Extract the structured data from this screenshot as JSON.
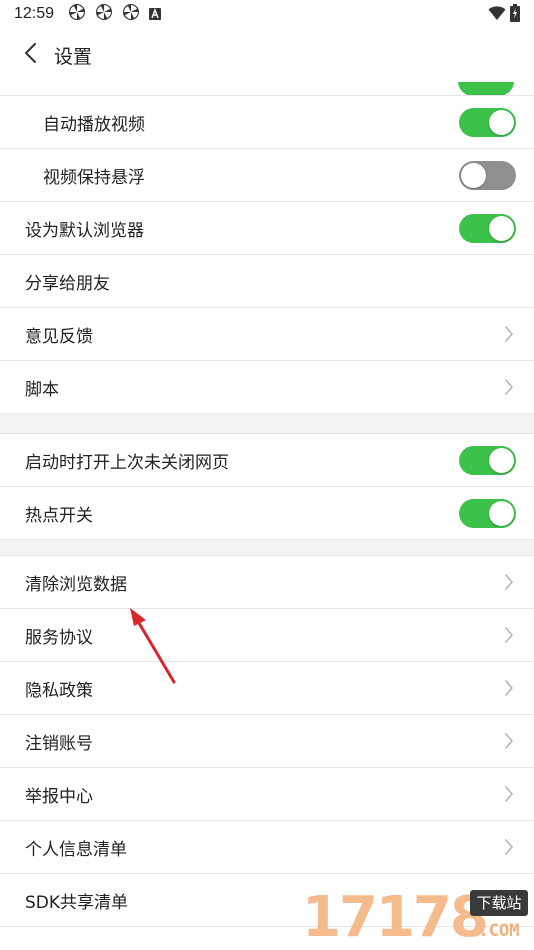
{
  "status_bar": {
    "time": "12:59",
    "notification_icons": [
      "pinwheel-icon",
      "pinwheel-icon",
      "pinwheel-icon",
      "a-square-icon"
    ]
  },
  "header": {
    "title": "设置"
  },
  "groups": [
    [
      {
        "label": "自动播放视频",
        "type": "toggle",
        "on": true,
        "indent": true
      },
      {
        "label": "视频保持悬浮",
        "type": "toggle",
        "on": false,
        "indent": true
      },
      {
        "label": "设为默认浏览器",
        "type": "toggle",
        "on": true,
        "indent": false
      },
      {
        "label": "分享给朋友",
        "type": "plain",
        "indent": false
      },
      {
        "label": "意见反馈",
        "type": "chevron",
        "indent": false
      },
      {
        "label": "脚本",
        "type": "chevron",
        "indent": false
      }
    ],
    [
      {
        "label": "启动时打开上次未关闭网页",
        "type": "toggle",
        "on": true,
        "indent": false
      },
      {
        "label": "热点开关",
        "type": "toggle",
        "on": true,
        "indent": false
      }
    ],
    [
      {
        "label": "清除浏览数据",
        "type": "chevron",
        "indent": false
      },
      {
        "label": "服务协议",
        "type": "chevron",
        "indent": false
      },
      {
        "label": "隐私政策",
        "type": "chevron",
        "indent": false
      },
      {
        "label": "注销账号",
        "type": "chevron",
        "indent": false
      },
      {
        "label": "举报中心",
        "type": "chevron",
        "indent": false
      },
      {
        "label": "个人信息清单",
        "type": "chevron",
        "indent": false
      },
      {
        "label": "SDK共享清单",
        "type": "plain",
        "indent": false
      }
    ]
  ],
  "watermark": {
    "number": "17178",
    "badge": "下载站",
    "suffix": ".COM"
  },
  "colors": {
    "toggle_on": "#3cc14a",
    "toggle_off": "#8f8f8f",
    "annotation_arrow": "#d9262c"
  }
}
